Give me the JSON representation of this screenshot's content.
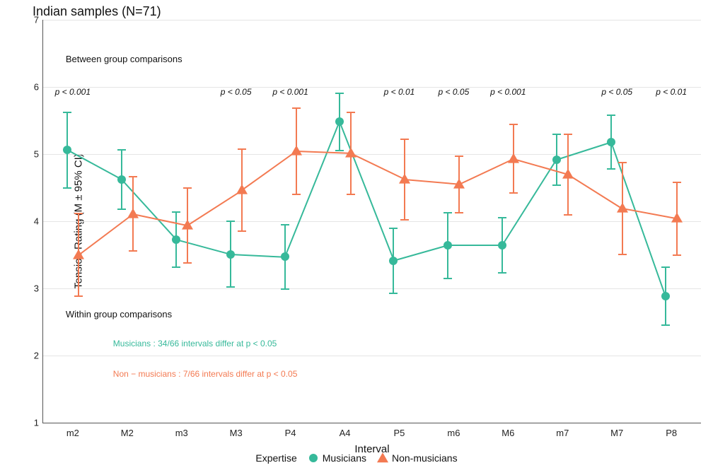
{
  "chart_data": {
    "type": "line",
    "title": "Indian samples (N=71)",
    "xlabel": "Interval",
    "ylabel": "Tension Rating (M ± 95% CI)",
    "ylim": [
      1,
      7
    ],
    "yticks": [
      1,
      2,
      3,
      4,
      5,
      6,
      7
    ],
    "categories": [
      "m2",
      "M2",
      "m3",
      "M3",
      "P4",
      "A4",
      "P5",
      "m6",
      "M6",
      "m7",
      "M7",
      "P8"
    ],
    "series": [
      {
        "name": "Musicians",
        "color": "#36b99a",
        "marker": "circle",
        "values": [
          5.06,
          4.62,
          3.73,
          3.51,
          3.47,
          5.48,
          3.41,
          3.64,
          3.64,
          4.92,
          5.18,
          2.88
        ],
        "ci_lo": [
          4.5,
          4.18,
          3.32,
          3.02,
          2.99,
          5.05,
          2.93,
          3.15,
          3.23,
          4.54,
          4.78,
          2.45
        ],
        "ci_hi": [
          5.62,
          5.06,
          4.14,
          4.0,
          3.95,
          5.91,
          3.89,
          4.13,
          4.05,
          5.3,
          5.58,
          3.32
        ]
      },
      {
        "name": "Non-musicians",
        "color": "#f37a52",
        "marker": "triangle",
        "values": [
          3.5,
          4.11,
          3.94,
          4.46,
          5.04,
          5.01,
          4.62,
          4.55,
          4.93,
          4.7,
          4.19,
          4.04
        ],
        "ci_lo": [
          2.88,
          3.56,
          3.38,
          3.85,
          4.4,
          4.4,
          4.02,
          4.13,
          4.42,
          4.1,
          3.51,
          3.5
        ],
        "ci_hi": [
          4.12,
          4.66,
          4.5,
          5.07,
          5.68,
          5.62,
          5.22,
          4.97,
          5.44,
          5.3,
          4.87,
          4.58
        ]
      }
    ],
    "legend": {
      "title": "Expertise",
      "position": "bottom"
    },
    "annotations": {
      "between_title": "Between group comparisons",
      "within_title": "Within group comparisons",
      "pvalues": {
        "m2": "p < 0.001",
        "M3": "p < 0.05",
        "P4": "p < 0.001",
        "P5": "p < 0.01",
        "m6": "p < 0.05",
        "M6": "p < 0.001",
        "M7": "p < 0.05",
        "P8": "p < 0.01"
      },
      "within_mus": "Musicians : 34/66 intervals differ at p < 0.05",
      "within_non": "Non − musicians : 7/66 intervals differ at p < 0.05"
    }
  }
}
